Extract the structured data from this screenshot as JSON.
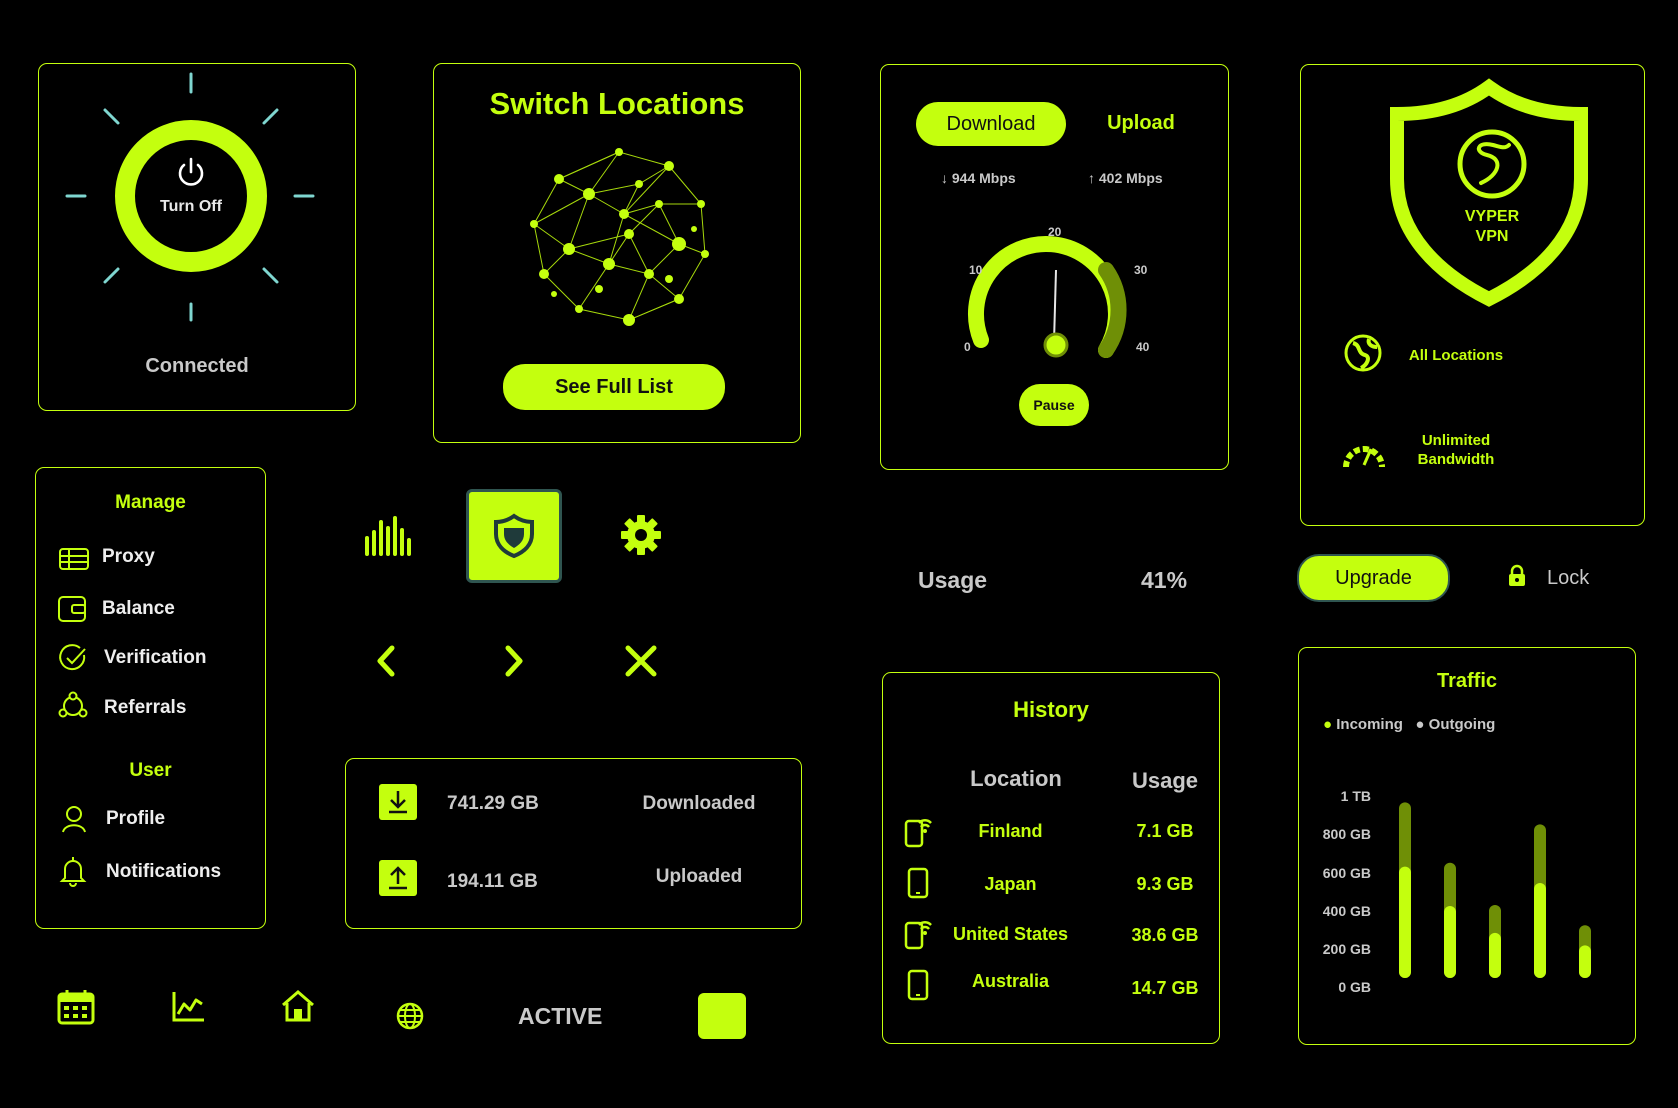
{
  "colors": {
    "accent": "#c4ff0e",
    "accent_dark": "#6f8f06",
    "muted": "#c9c9c9",
    "tick": "#7fd6d0",
    "background": "#000000"
  },
  "power": {
    "button_label": "Turn Off",
    "status": "Connected",
    "icon": "power-icon"
  },
  "locations": {
    "title": "Switch Locations",
    "button": "See Full List",
    "icon": "globe-network-icon"
  },
  "speed": {
    "tabs": [
      "Download",
      "Upload"
    ],
    "download_rate": "944 Mbps",
    "upload_rate": "402 Mbps",
    "gauge_labels": [
      "0",
      "10",
      "20",
      "30",
      "40"
    ],
    "gauge_value": 20,
    "gauge_max": 40,
    "button": "Pause"
  },
  "shield": {
    "brand": [
      "VYPER",
      "VPN"
    ],
    "features": [
      {
        "label": "All Locations",
        "icon": "globe-icon"
      },
      {
        "label": "Unlimited Bandwidth",
        "icon": "speedometer-icon"
      }
    ]
  },
  "menu": {
    "manage_title": "Manage",
    "manage_items": [
      {
        "label": "Proxy",
        "icon": "proxy-icon"
      },
      {
        "label": "Balance",
        "icon": "wallet-icon"
      },
      {
        "label": "Verification",
        "icon": "check-circle-icon"
      },
      {
        "label": "Referrals",
        "icon": "referrals-icon"
      }
    ],
    "user_title": "User",
    "user_items": [
      {
        "label": "Profile",
        "icon": "user-icon"
      },
      {
        "label": "Notifications",
        "icon": "bell-icon"
      }
    ]
  },
  "toolbar_icons": [
    "bar-chart-icon",
    "shield-icon",
    "gear-icon",
    "chevron-left-icon",
    "chevron-right-icon",
    "close-icon"
  ],
  "transfer": {
    "rows": [
      {
        "value": "741.29 GB",
        "label": "Downloaded",
        "icon": "download-icon"
      },
      {
        "value": "194.11 GB",
        "label": "Uploaded",
        "icon": "upload-icon"
      }
    ]
  },
  "usage": {
    "label": "Usage",
    "percent": "41%"
  },
  "upgrade": {
    "button": "Upgrade",
    "lock_label": "Lock"
  },
  "history": {
    "title": "History",
    "headers": [
      "Location",
      "Usage"
    ],
    "rows": [
      {
        "location": "Finland",
        "usage": "7.1 GB",
        "icon": "phone-wifi-icon"
      },
      {
        "location": "Japan",
        "usage": "9.3 GB",
        "icon": "phone-icon"
      },
      {
        "location": "United States",
        "usage": "38.6 GB",
        "icon": "phone-wifi-icon"
      },
      {
        "location": "Australia",
        "usage": "14.7 GB",
        "icon": "phone-icon"
      }
    ]
  },
  "traffic": {
    "title": "Traffic",
    "legend": [
      "Incoming",
      "Outgoing"
    ],
    "y_labels": [
      "1 TB",
      "800 GB",
      "600 GB",
      "400 GB",
      "200 GB",
      "0 GB"
    ]
  },
  "chart_data": {
    "type": "bar",
    "title": "Traffic",
    "ylim": [
      0,
      1000
    ],
    "series": [
      {
        "name": "Incoming",
        "values": [
          580,
          375,
          235,
          495,
          170
        ]
      },
      {
        "name": "Outgoing",
        "values": [
          915,
          600,
          380,
          800,
          275
        ]
      }
    ]
  },
  "bottom_nav": {
    "icons": [
      "calendar-icon",
      "line-chart-icon",
      "home-icon",
      "globe-icon"
    ],
    "active_label": "ACTIVE"
  }
}
